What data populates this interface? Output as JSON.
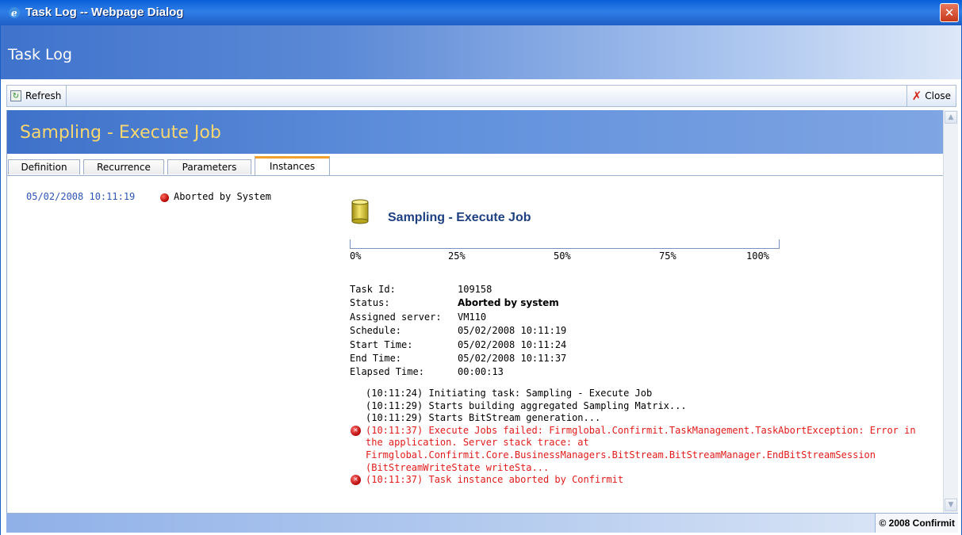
{
  "window": {
    "title": "Task Log -- Webpage Dialog",
    "close_glyph": "✕"
  },
  "header": {
    "title": "Task Log"
  },
  "toolbar": {
    "refresh_label": "Refresh",
    "close_label": "Close"
  },
  "job": {
    "banner_title": "Sampling - Execute Job",
    "heading": "Sampling - Execute Job"
  },
  "tabs": [
    {
      "label": "Definition",
      "active": false
    },
    {
      "label": "Recurrence",
      "active": false
    },
    {
      "label": "Parameters",
      "active": false
    },
    {
      "label": "Instances",
      "active": true
    }
  ],
  "instance": {
    "timestamp": "05/02/2008 10:11:19",
    "status": "Aborted by System"
  },
  "progress": {
    "value_percent": 0,
    "ticks": [
      "0%",
      "25%",
      "50%",
      "75%",
      "100%"
    ]
  },
  "details": [
    {
      "label": "Task Id:",
      "value": "109158",
      "strong": false
    },
    {
      "label": "Status:",
      "value": "Aborted by system",
      "strong": true
    },
    {
      "label": "Assigned server:",
      "value": "VM110",
      "strong": false
    },
    {
      "label": "Schedule:",
      "value": "05/02/2008 10:11:19",
      "strong": false
    },
    {
      "label": "Start Time:",
      "value": "05/02/2008 10:11:24",
      "strong": false
    },
    {
      "label": "End Time:",
      "value": "05/02/2008 10:11:37",
      "strong": false
    },
    {
      "label": "Elapsed Time:",
      "value": "00:00:13",
      "strong": false
    }
  ],
  "log": [
    {
      "text": "(10:11:24) Initiating task: Sampling - Execute Job",
      "error": false
    },
    {
      "text": "(10:11:29) Starts building aggregated Sampling Matrix...",
      "error": false
    },
    {
      "text": "(10:11:29) Starts BitStream generation...",
      "error": false
    },
    {
      "text": "(10:11:37) Execute Jobs failed: Firmglobal.Confirmit.TaskManagement.TaskAbortException: Error in the application. Server stack trace: at Firmglobal.Confirmit.Core.BusinessManagers.BitStream.BitStreamManager.EndBitStreamSession (BitStreamWriteState writeSta...",
      "error": true
    },
    {
      "text": "(10:11:37) Task instance aborted by Confirmit",
      "error": true
    }
  ],
  "footer": {
    "copyright": "© 2008 Confirmit"
  },
  "colors": {
    "error": "#e21a1a",
    "link": "#2d55b5",
    "banner_title": "#f6d772",
    "tab_active_accent": "#f2a12c"
  }
}
